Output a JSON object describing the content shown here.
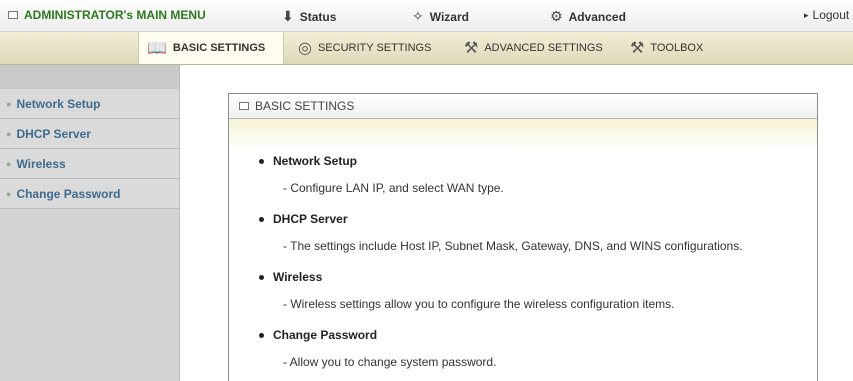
{
  "topbar": {
    "admin_label": "ADMINISTRATOR's MAIN MENU",
    "nav": [
      {
        "label": "Status",
        "icon": "status-icon"
      },
      {
        "label": "Wizard",
        "icon": "wizard-icon"
      },
      {
        "label": "Advanced",
        "icon": "advanced-icon"
      }
    ],
    "logout_label": "Logout"
  },
  "tabs": [
    {
      "label": "BASIC SETTINGS",
      "icon": "basic-settings-icon",
      "active": true
    },
    {
      "label": "SECURITY SETTINGS",
      "icon": "security-settings-icon",
      "active": false
    },
    {
      "label": "ADVANCED SETTINGS",
      "icon": "advanced-settings-icon",
      "active": false
    },
    {
      "label": "TOOLBOX",
      "icon": "toolbox-icon",
      "active": false
    }
  ],
  "sidebar": {
    "items": [
      {
        "label": "Network Setup"
      },
      {
        "label": "DHCP Server"
      },
      {
        "label": "Wireless"
      },
      {
        "label": "Change Password"
      }
    ]
  },
  "panel": {
    "title": "BASIC SETTINGS",
    "entries": [
      {
        "title": "Network Setup",
        "desc": "- Configure LAN IP, and select WAN type."
      },
      {
        "title": "DHCP Server",
        "desc": "- The settings include Host IP, Subnet Mask, Gateway, DNS, and WINS configurations."
      },
      {
        "title": "Wireless",
        "desc": "- Wireless settings allow you to configure the wireless configuration items."
      },
      {
        "title": "Change Password",
        "desc": "- Allow you to change system password."
      }
    ]
  },
  "colors": {
    "admin_text": "#2d7a1e",
    "sidebar_link": "#3d6b8e",
    "tab_bar": "#dcd8b8"
  }
}
